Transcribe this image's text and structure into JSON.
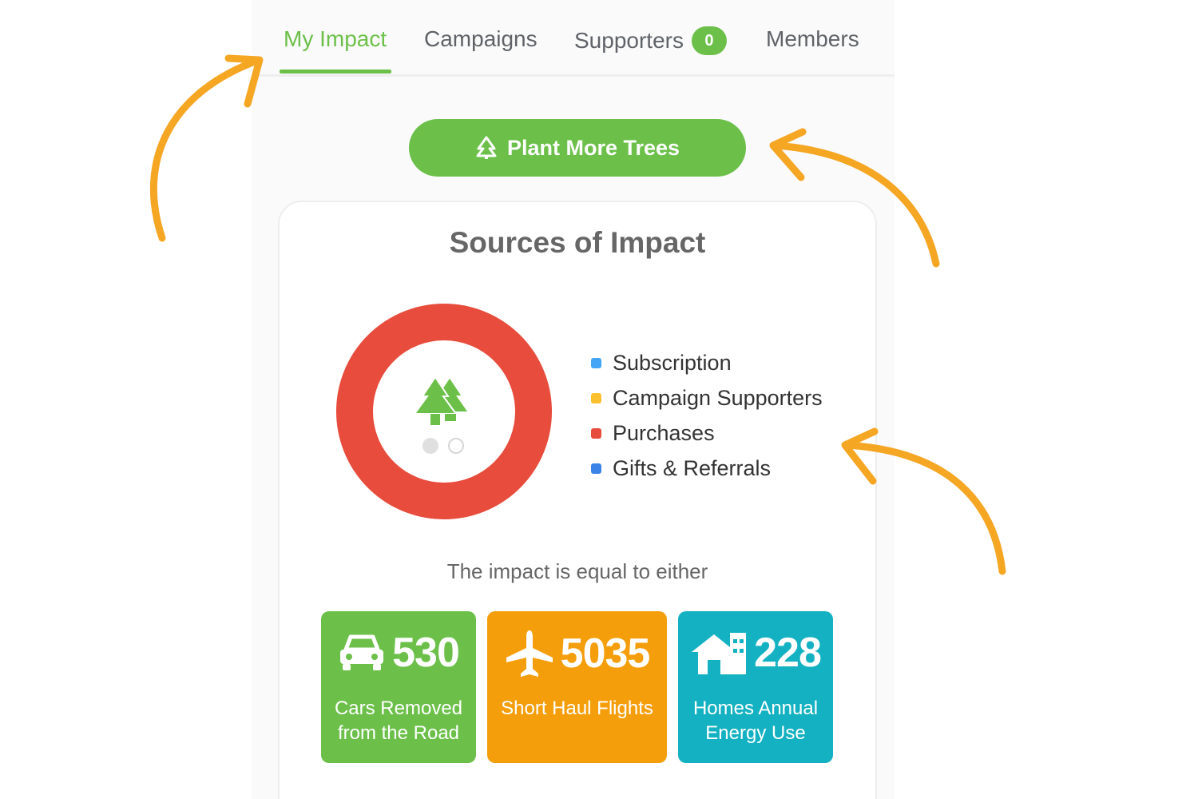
{
  "tabs": [
    {
      "label": "My Impact"
    },
    {
      "label": "Campaigns"
    },
    {
      "label": "Supporters",
      "badge": "0"
    },
    {
      "label": "Members"
    }
  ],
  "plant_button": {
    "label": "Plant More Trees",
    "icon": "tree-icon"
  },
  "impact_card": {
    "title": "Sources of Impact",
    "legend": [
      {
        "label": "Subscription",
        "color": "#42a5f5"
      },
      {
        "label": "Campaign Supporters",
        "color": "#fbc02d"
      },
      {
        "label": "Purchases",
        "color": "#e74c3c"
      },
      {
        "label": "Gifts & Referrals",
        "color": "#3b82e6"
      }
    ],
    "equal_text": "The impact is equal to either",
    "stats": [
      {
        "value": "530",
        "label_line1": "Cars Removed",
        "label_line2": "from the Road",
        "icon": "car-icon",
        "color": "#6cc04a"
      },
      {
        "value": "5035",
        "label_line1": "Short Haul Flights",
        "label_line2": "",
        "icon": "airplane-icon",
        "color": "#f59e0b"
      },
      {
        "value": "228",
        "label_line1": "Homes Annual",
        "label_line2": "Energy Use",
        "icon": "home-icon",
        "color": "#14b1c2"
      }
    ]
  },
  "chart_data": {
    "type": "pie",
    "categories": [
      "Subscription",
      "Campaign Supporters",
      "Purchases",
      "Gifts & Referrals"
    ],
    "values": [
      0,
      0,
      100,
      0
    ],
    "title": "Sources of Impact",
    "legend_position": "right"
  },
  "colors": {
    "accent": "#6cc04a",
    "annotation_arrow": "#f5a623"
  }
}
